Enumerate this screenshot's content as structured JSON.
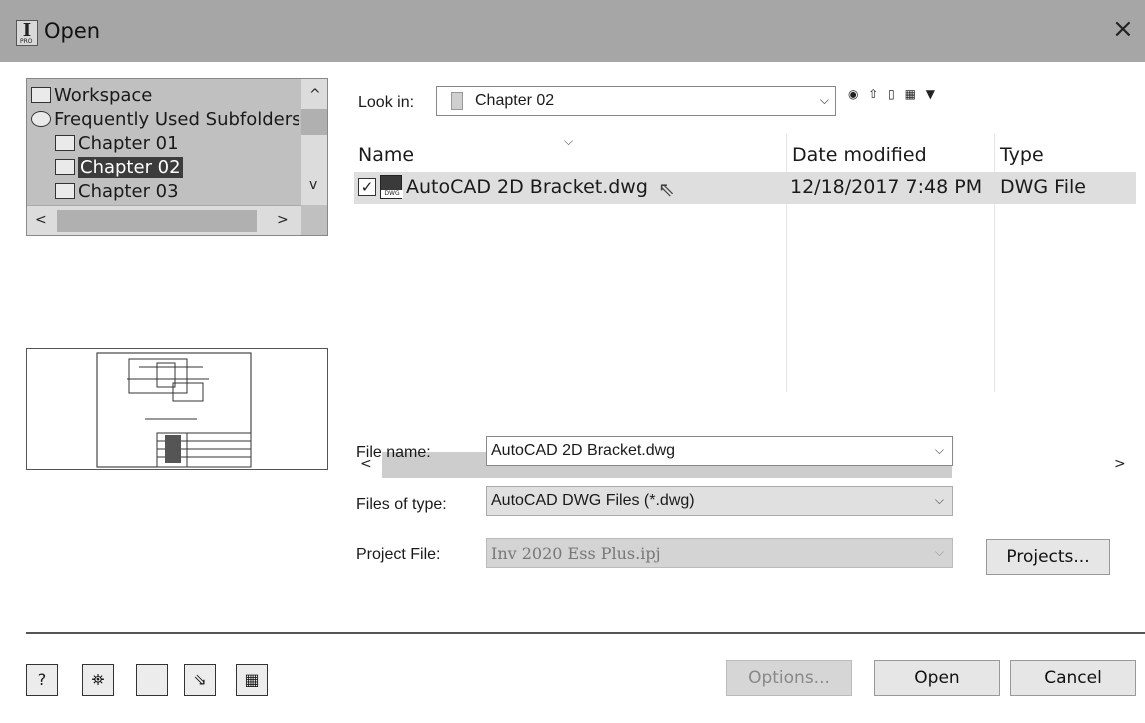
{
  "window": {
    "title": "Open",
    "app_icon_letter": "I",
    "app_icon_sub": "PRO",
    "close_glyph": "×"
  },
  "folder_tree": {
    "items": [
      {
        "label": "Workspace",
        "selected": false
      },
      {
        "label": "Frequently Used Subfolders",
        "selected": false
      },
      {
        "label": "Chapter 01",
        "selected": false
      },
      {
        "label": "Chapter 02",
        "selected": true
      },
      {
        "label": "Chapter 03",
        "selected": false
      }
    ],
    "scroll_up": "^",
    "scroll_down": "v",
    "scroll_left": "<",
    "scroll_right": ">"
  },
  "look_in": {
    "label": "Look in:",
    "value": "Chapter 02",
    "dropdown_glyph": "⌵",
    "toolbar_glyphs": "◉ ⇧ ▯ ▦ ▼"
  },
  "file_list": {
    "sort_glyph": "⌵",
    "columns": [
      "Name",
      "Date modified",
      "Type"
    ],
    "rows": [
      {
        "name": "AutoCAD 2D Bracket.dwg",
        "date_modified": "12/18/2017 7:48 PM",
        "type": "DWG File",
        "checked": true
      }
    ],
    "file_icon_text": "DWG",
    "check_glyph": "✓",
    "cursor_glyph": "⇖",
    "scroll_left": "<",
    "scroll_right": ">"
  },
  "fields": {
    "file_name": {
      "label": "File name:",
      "value": "AutoCAD 2D Bracket.dwg"
    },
    "files_of_type": {
      "label": "Files of type:",
      "value": "AutoCAD DWG Files (*.dwg)"
    },
    "project_file": {
      "label": "Project File:",
      "value": "Inv 2020 Ess Plus.ipj"
    },
    "dropdown_glyph": "⌵"
  },
  "buttons": {
    "projects": "Projects...",
    "options": "Options...",
    "open": "Open",
    "cancel": "Cancel"
  },
  "bottom_tools": [
    {
      "name": "help-icon",
      "glyph": "?"
    },
    {
      "name": "find-icon",
      "glyph": "⛯"
    },
    {
      "name": "new-file-icon",
      "glyph": ""
    },
    {
      "name": "import-icon",
      "glyph": "⇘"
    },
    {
      "name": "library-icon",
      "glyph": "▦"
    }
  ],
  "colors": {
    "titlebar": "#a6a6a6",
    "tree_background": "#c0c0c0",
    "selection": "#3c3c3c",
    "row_highlight": "#dedede"
  }
}
